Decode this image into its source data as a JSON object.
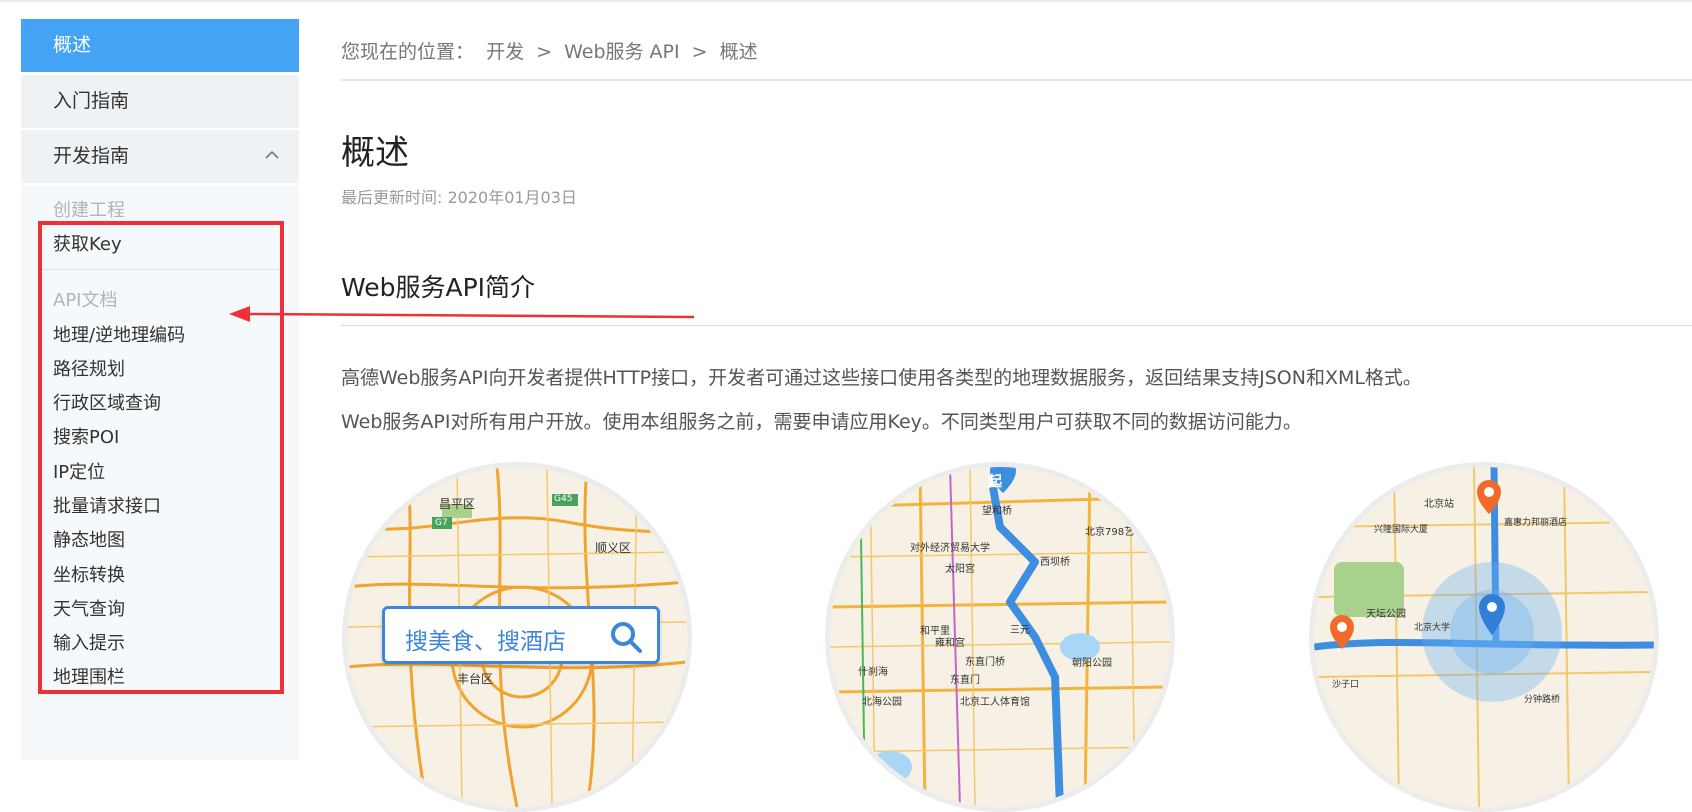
{
  "sidebar": {
    "items": [
      {
        "label": "概述"
      },
      {
        "label": "入门指南"
      },
      {
        "label": "开发指南"
      }
    ],
    "sub_items": {
      "create_project": "创建工程",
      "get_key": "获取Key",
      "api_docs_category": "API文档",
      "geocoding": "地理/逆地理编码",
      "route_planning": "路径规划",
      "district_search": "行政区域查询",
      "search_poi": "搜索POI",
      "ip_location": "IP定位",
      "batch_request": "批量请求接口",
      "static_map": "静态地图",
      "coord_convert": "坐标转换",
      "weather": "天气查询",
      "input_tips": "输入提示",
      "geofence": "地理围栏"
    }
  },
  "breadcrumb": {
    "prefix": "您现在的位置：",
    "path": [
      "开发",
      ">",
      "Web服务 API",
      ">",
      "概述"
    ]
  },
  "page": {
    "title": "概述",
    "updated": "最后更新时间: 2020年01月03日",
    "section_title": "Web服务API简介",
    "para1": "高德Web服务API向开发者提供HTTP接口，开发者可通过这些接口使用各类型的地理数据服务，返回结果支持JSON和XML格式。",
    "para2": "Web服务API对所有用户开放。使用本组服务之前，需要申请应用Key。不同类型用户可获取不同的数据访问能力。"
  },
  "map1": {
    "search_text": "搜美食、搜酒店",
    "labels": [
      "昌平区",
      "顺义区",
      "丰台区",
      "G45",
      "G7"
    ]
  },
  "map2": {
    "start_marker": "起",
    "labels": [
      "望和桥",
      "北京798艺",
      "对外经济贸易大学",
      "太阳宫",
      "西坝桥",
      "和平里",
      "三元",
      "雍和宫",
      "东直门桥",
      "东直门",
      "北海公园",
      "北京工人体育馆",
      "朝阳公园",
      "什刹海"
    ]
  },
  "map3": {
    "labels": [
      "北京站",
      "兴隆国际大厦",
      "嘉惠力邦丽酒店",
      "天坛公园",
      "北京大学",
      "分钟路桥",
      "沙子口"
    ]
  },
  "colors": {
    "accent": "#44a3f5",
    "highlight_red": "#ed3137",
    "sidebar_bg": "#eef2f5"
  }
}
